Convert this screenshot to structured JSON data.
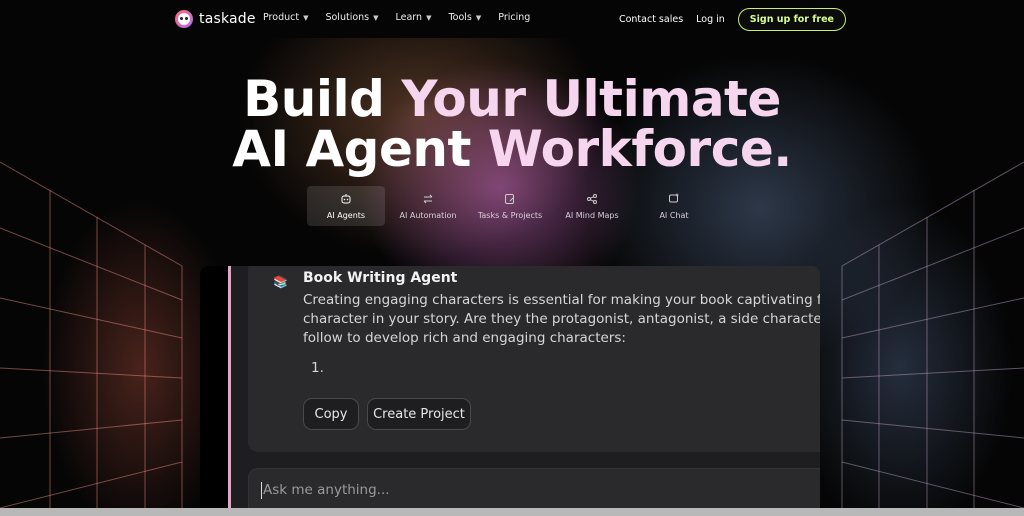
{
  "brand": {
    "name": "taskade"
  },
  "nav": {
    "links": [
      {
        "label": "Product",
        "dropdown": true
      },
      {
        "label": "Solutions",
        "dropdown": true
      },
      {
        "label": "Learn",
        "dropdown": true
      },
      {
        "label": "Tools",
        "dropdown": true
      },
      {
        "label": "Pricing",
        "dropdown": false
      }
    ],
    "contact_sales": "Contact sales",
    "login": "Log in",
    "signup": "Sign up for free"
  },
  "hero": {
    "line1_a": "Build",
    "line1_b": "Your Ultimate",
    "line2_a": "AI Agent",
    "line2_b": "Workforce."
  },
  "tabs": [
    {
      "label": "AI Agents",
      "icon": "robot-icon",
      "active": true
    },
    {
      "label": "AI Automation",
      "icon": "flow-icon",
      "active": false
    },
    {
      "label": "Tasks & Projects",
      "icon": "task-edit-icon",
      "active": false
    },
    {
      "label": "AI Mind Maps",
      "icon": "share-nodes-icon",
      "active": false
    },
    {
      "label": "AI Chat",
      "icon": "chat-plus-icon",
      "active": false
    }
  ],
  "chat": {
    "agent_icon": "📚",
    "agent_name": "Book Writing Agent",
    "body_line1": "Creating engaging characters is essential for making your book captivating for",
    "body_line2": "character in your story. Are they the protagonist, antagonist, a side character, o",
    "body_line3": "follow to develop rich and engaging characters:",
    "list_item": "1.",
    "copy_label": "Copy",
    "create_project_label": "Create Project",
    "input_placeholder": "Ask me anything..."
  },
  "colors": {
    "signup_accent": "#c8f06e",
    "headline_pink": "#f6d6ee",
    "panel_accent": "#e6a4c6"
  }
}
